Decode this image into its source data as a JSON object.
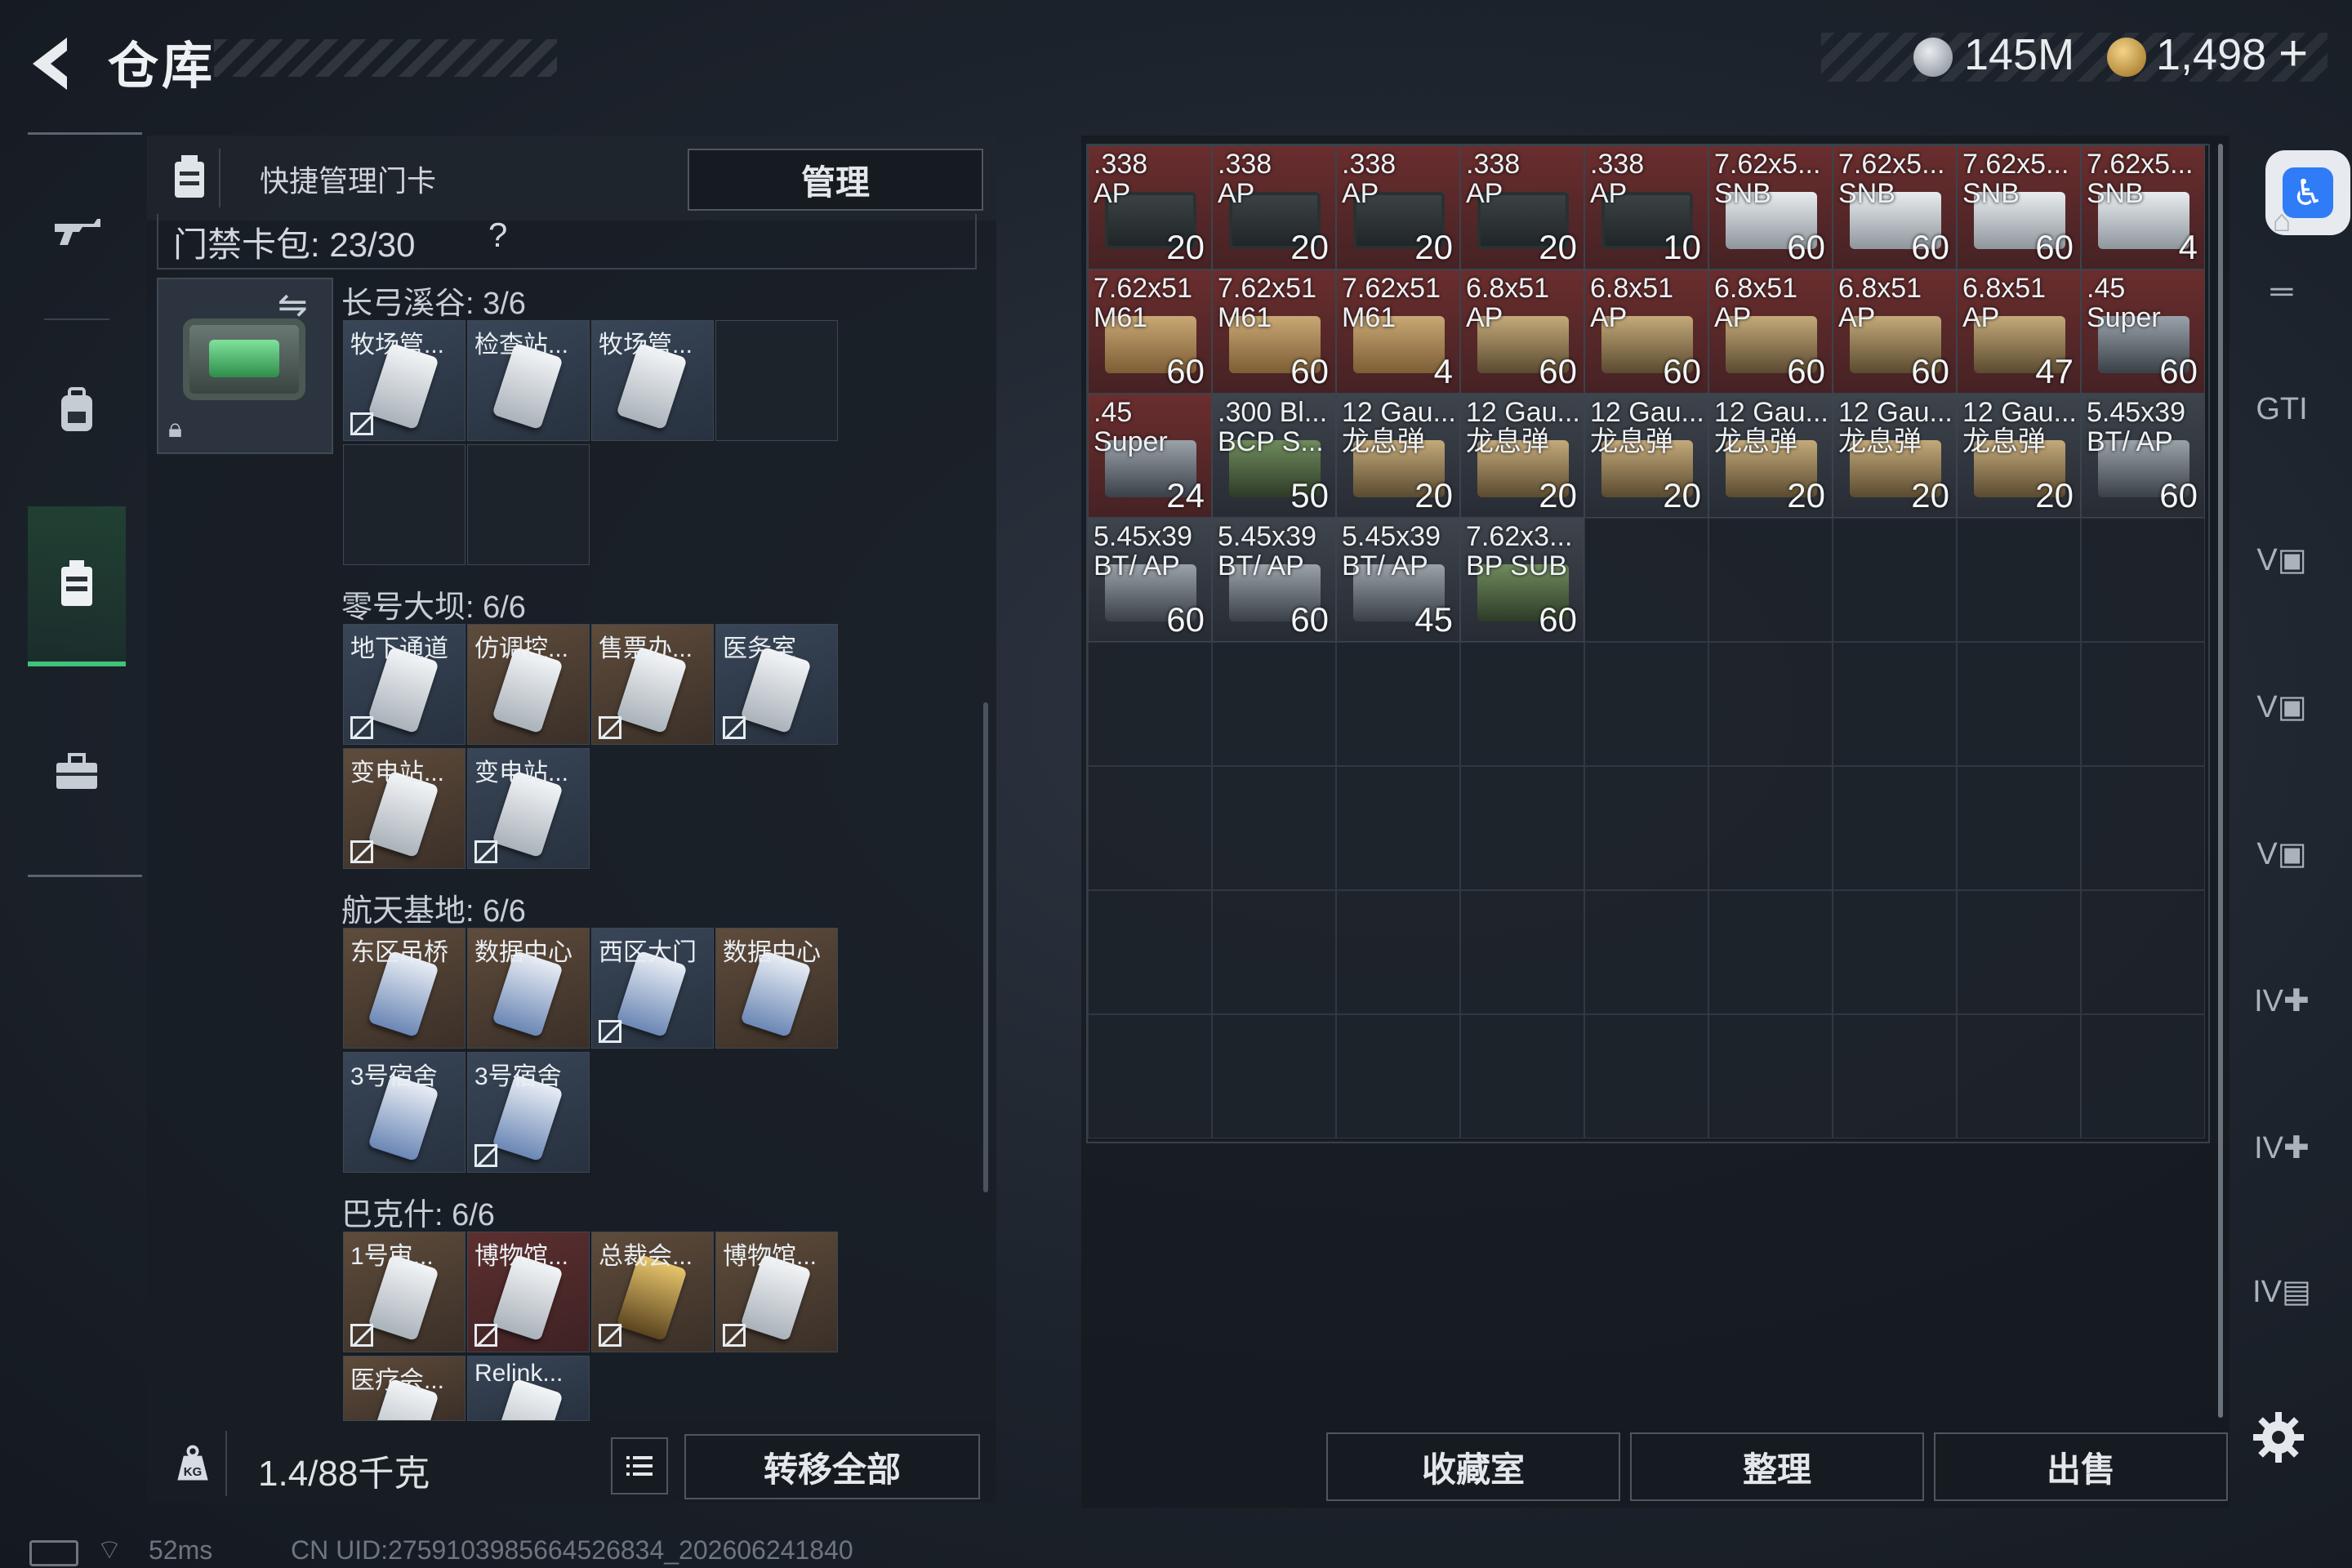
{
  "header": {
    "title": "仓库",
    "currency": [
      {
        "icon": "silver-coin-icon",
        "value": "145M"
      },
      {
        "icon": "gold-coin-icon",
        "value": "1,498"
      }
    ],
    "add_label": "+"
  },
  "leftnav": [
    {
      "icon": "gun-icon"
    },
    {
      "icon": "backpack-icon"
    },
    {
      "icon": "keycard-holder-icon",
      "active": true
    },
    {
      "icon": "toolbox-icon"
    }
  ],
  "keycards": {
    "header_title": "快捷管理门卡",
    "manage_label": "管理",
    "count_label": "门禁卡包: 23/30",
    "help_label": "?",
    "groups": [
      {
        "name": "长弓溪谷: 3/6",
        "slots": [
          {
            "label": "牧场管...",
            "bg": "blue",
            "card": "white",
            "unbound": true
          },
          {
            "label": "检查站...",
            "bg": "blue",
            "card": "white",
            "unbound": false
          },
          {
            "label": "牧场管...",
            "bg": "blue",
            "card": "white",
            "unbound": false
          },
          {
            "label": "",
            "bg": "empty"
          },
          {
            "label": "",
            "bg": "empty"
          },
          {
            "label": "",
            "bg": "empty"
          }
        ]
      },
      {
        "name": "零号大坝: 6/6",
        "slots": [
          {
            "label": "地下通道",
            "bg": "blue",
            "card": "white",
            "unbound": true
          },
          {
            "label": "仿调控...",
            "bg": "brown",
            "card": "white",
            "unbound": false
          },
          {
            "label": "售票办...",
            "bg": "brown",
            "card": "white",
            "unbound": true
          },
          {
            "label": "医务室",
            "bg": "blue",
            "card": "white",
            "unbound": true
          },
          {
            "label": "变电站...",
            "bg": "brown",
            "card": "white",
            "unbound": true
          },
          {
            "label": "变电站...",
            "bg": "blue",
            "card": "white",
            "unbound": true
          }
        ]
      },
      {
        "name": "航天基地: 6/6",
        "slots": [
          {
            "label": "东区吊桥",
            "bg": "brown",
            "card": "bluecard",
            "unbound": false
          },
          {
            "label": "数据中心",
            "bg": "brown",
            "card": "bluecard",
            "unbound": false
          },
          {
            "label": "西区大门",
            "bg": "blue",
            "card": "bluecard",
            "unbound": true
          },
          {
            "label": "数据中心",
            "bg": "brown",
            "card": "bluecard",
            "unbound": false
          },
          {
            "label": "3号宿舍",
            "bg": "blue",
            "card": "bluecard",
            "unbound": false
          },
          {
            "label": "3号宿舍",
            "bg": "blue",
            "card": "bluecard",
            "unbound": true
          }
        ]
      },
      {
        "name": "巴克什: 6/6",
        "slots": [
          {
            "label": "1号审...",
            "bg": "brown",
            "card": "white",
            "unbound": true
          },
          {
            "label": "博物馆...",
            "bg": "red",
            "card": "white",
            "unbound": true
          },
          {
            "label": "总裁会...",
            "bg": "brown",
            "card": "goldcard",
            "unbound": true
          },
          {
            "label": "博物馆...",
            "bg": "brown",
            "card": "white",
            "unbound": true
          },
          {
            "label": "医疗会...",
            "bg": "brown",
            "card": "white",
            "unbound": false
          },
          {
            "label": "Relink...",
            "bg": "blue",
            "card": "white",
            "unbound": false
          }
        ]
      }
    ],
    "weight": "1.4/88千克",
    "transfer_all_label": "转移全部"
  },
  "warehouse": {
    "items": [
      {
        "name": ".338\nAP",
        "count": "20",
        "color": "red",
        "box": "ammo-dark"
      },
      {
        "name": ".338\nAP",
        "count": "20",
        "color": "red",
        "box": "ammo-dark"
      },
      {
        "name": ".338\nAP",
        "count": "20",
        "color": "red",
        "box": "ammo-dark"
      },
      {
        "name": ".338\nAP",
        "count": "20",
        "color": "red",
        "box": "ammo-dark"
      },
      {
        "name": ".338\nAP",
        "count": "10",
        "color": "red",
        "box": "ammo-dark"
      },
      {
        "name": "7.62x5...\nSNB",
        "count": "60",
        "color": "red",
        "box": "ammo-white"
      },
      {
        "name": "7.62x5...\nSNB",
        "count": "60",
        "color": "red",
        "box": "ammo-white"
      },
      {
        "name": "7.62x5...\nSNB",
        "count": "60",
        "color": "red",
        "box": "ammo-white"
      },
      {
        "name": "7.62x5...\nSNB",
        "count": "4",
        "color": "red",
        "box": "ammo-white"
      },
      {
        "name": "7.62x51\nM61",
        "count": "60",
        "color": "red",
        "box": "ammo-tan"
      },
      {
        "name": "7.62x51\nM61",
        "count": "60",
        "color": "red",
        "box": "ammo-tan"
      },
      {
        "name": "7.62x51\nM61",
        "count": "4",
        "color": "red",
        "box": "ammo-tan"
      },
      {
        "name": "6.8x51\nAP",
        "count": "60",
        "color": "red",
        "box": "ammo-bronze"
      },
      {
        "name": "6.8x51\nAP",
        "count": "60",
        "color": "red",
        "box": "ammo-bronze"
      },
      {
        "name": "6.8x51\nAP",
        "count": "60",
        "color": "red",
        "box": "ammo-bronze"
      },
      {
        "name": "6.8x51\nAP",
        "count": "60",
        "color": "red",
        "box": "ammo-bronze"
      },
      {
        "name": "6.8x51\nAP",
        "count": "47",
        "color": "red",
        "box": "ammo-bronze"
      },
      {
        "name": ".45\nSuper",
        "count": "60",
        "color": "red",
        "box": "ammo-silver"
      },
      {
        "name": ".45\nSuper",
        "count": "24",
        "color": "red",
        "box": "ammo-silver"
      },
      {
        "name": ".300 Bl...\nBCP S...",
        "count": "50",
        "color": "dark",
        "box": "ammo-green"
      },
      {
        "name": "12 Gau...\n龙息弹",
        "count": "20",
        "color": "dark",
        "box": "ammo-bronze"
      },
      {
        "name": "12 Gau...\n龙息弹",
        "count": "20",
        "color": "dark",
        "box": "ammo-bronze"
      },
      {
        "name": "12 Gau...\n龙息弹",
        "count": "20",
        "color": "dark",
        "box": "ammo-bronze"
      },
      {
        "name": "12 Gau...\n龙息弹",
        "count": "20",
        "color": "dark",
        "box": "ammo-bronze"
      },
      {
        "name": "12 Gau...\n龙息弹",
        "count": "20",
        "color": "dark",
        "box": "ammo-bronze"
      },
      {
        "name": "12 Gau...\n龙息弹",
        "count": "20",
        "color": "dark",
        "box": "ammo-bronze"
      },
      {
        "name": "5.45x39\nBT/ AP",
        "count": "60",
        "color": "dark",
        "box": "ammo-silver"
      },
      {
        "name": "5.45x39\nBT/ AP",
        "count": "60",
        "color": "dark",
        "box": "ammo-silver"
      },
      {
        "name": "5.45x39\nBT/ AP",
        "count": "60",
        "color": "dark",
        "box": "ammo-silver"
      },
      {
        "name": "5.45x39\nBT/ AP",
        "count": "45",
        "color": "dark",
        "box": "ammo-silver"
      },
      {
        "name": "7.62x3...\nBP SUB",
        "count": "60",
        "color": "dark",
        "box": "ammo-green"
      }
    ],
    "rows": 8,
    "cols": 9,
    "buttons": {
      "collection": "收藏室",
      "arrange": "整理",
      "sell": "出售"
    }
  },
  "right_sidebar": [
    {
      "icon": "stash-home-icon"
    },
    {
      "icon": "rifle-rack-icon"
    },
    {
      "icon": "gti-vehicle-icon"
    },
    {
      "icon": "v-safe-icon"
    },
    {
      "icon": "v-safe-icon"
    },
    {
      "icon": "v-safe-icon"
    },
    {
      "icon": "iv-medkit-icon"
    },
    {
      "icon": "iv-medkit-icon"
    },
    {
      "icon": "iv-folder-icon"
    }
  ],
  "status_bar": {
    "ping": "52ms",
    "uid": "CN UID:2759103985664526834_202606241840"
  },
  "colors": {
    "accent_green": "#3fc27a",
    "item_red": "#6e2e2e",
    "accessibility_blue": "#2f7cf6"
  }
}
